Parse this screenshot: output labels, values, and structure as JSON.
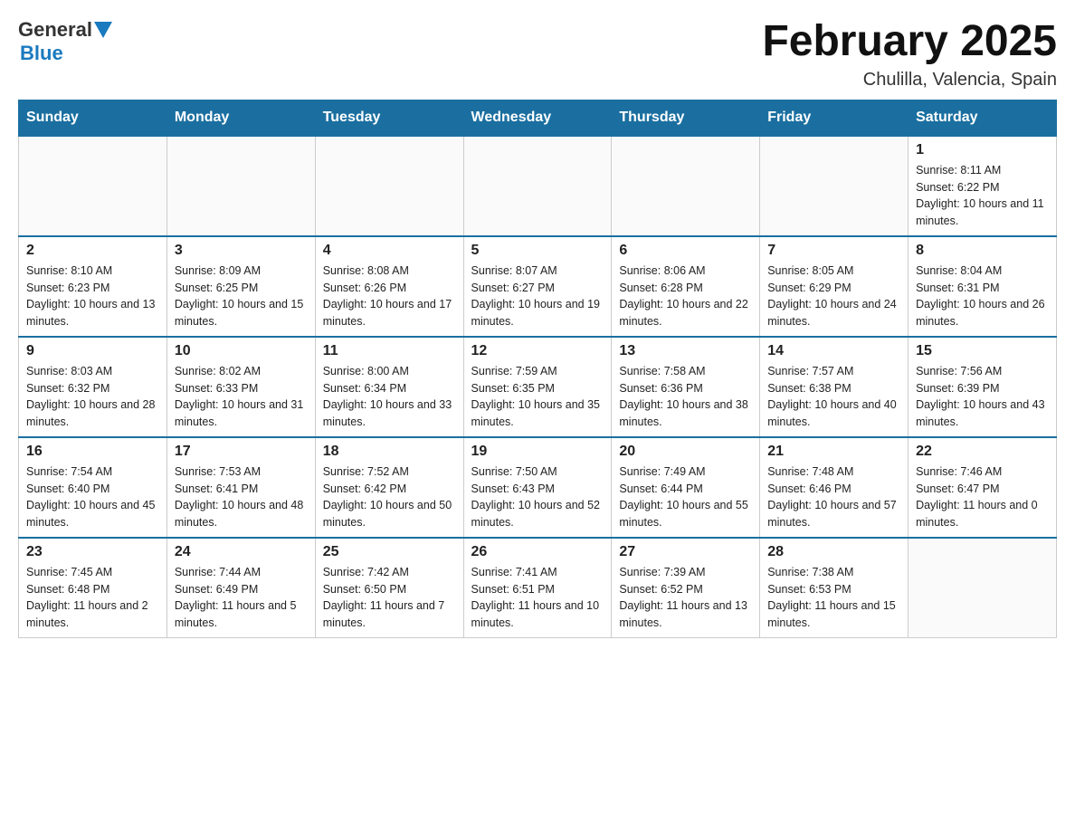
{
  "logo": {
    "general": "General",
    "blue": "Blue"
  },
  "title": "February 2025",
  "subtitle": "Chulilla, Valencia, Spain",
  "days_of_week": [
    "Sunday",
    "Monday",
    "Tuesday",
    "Wednesday",
    "Thursday",
    "Friday",
    "Saturday"
  ],
  "weeks": [
    [
      {
        "day": "",
        "info": ""
      },
      {
        "day": "",
        "info": ""
      },
      {
        "day": "",
        "info": ""
      },
      {
        "day": "",
        "info": ""
      },
      {
        "day": "",
        "info": ""
      },
      {
        "day": "",
        "info": ""
      },
      {
        "day": "1",
        "info": "Sunrise: 8:11 AM\nSunset: 6:22 PM\nDaylight: 10 hours and 11 minutes."
      }
    ],
    [
      {
        "day": "2",
        "info": "Sunrise: 8:10 AM\nSunset: 6:23 PM\nDaylight: 10 hours and 13 minutes."
      },
      {
        "day": "3",
        "info": "Sunrise: 8:09 AM\nSunset: 6:25 PM\nDaylight: 10 hours and 15 minutes."
      },
      {
        "day": "4",
        "info": "Sunrise: 8:08 AM\nSunset: 6:26 PM\nDaylight: 10 hours and 17 minutes."
      },
      {
        "day": "5",
        "info": "Sunrise: 8:07 AM\nSunset: 6:27 PM\nDaylight: 10 hours and 19 minutes."
      },
      {
        "day": "6",
        "info": "Sunrise: 8:06 AM\nSunset: 6:28 PM\nDaylight: 10 hours and 22 minutes."
      },
      {
        "day": "7",
        "info": "Sunrise: 8:05 AM\nSunset: 6:29 PM\nDaylight: 10 hours and 24 minutes."
      },
      {
        "day": "8",
        "info": "Sunrise: 8:04 AM\nSunset: 6:31 PM\nDaylight: 10 hours and 26 minutes."
      }
    ],
    [
      {
        "day": "9",
        "info": "Sunrise: 8:03 AM\nSunset: 6:32 PM\nDaylight: 10 hours and 28 minutes."
      },
      {
        "day": "10",
        "info": "Sunrise: 8:02 AM\nSunset: 6:33 PM\nDaylight: 10 hours and 31 minutes."
      },
      {
        "day": "11",
        "info": "Sunrise: 8:00 AM\nSunset: 6:34 PM\nDaylight: 10 hours and 33 minutes."
      },
      {
        "day": "12",
        "info": "Sunrise: 7:59 AM\nSunset: 6:35 PM\nDaylight: 10 hours and 35 minutes."
      },
      {
        "day": "13",
        "info": "Sunrise: 7:58 AM\nSunset: 6:36 PM\nDaylight: 10 hours and 38 minutes."
      },
      {
        "day": "14",
        "info": "Sunrise: 7:57 AM\nSunset: 6:38 PM\nDaylight: 10 hours and 40 minutes."
      },
      {
        "day": "15",
        "info": "Sunrise: 7:56 AM\nSunset: 6:39 PM\nDaylight: 10 hours and 43 minutes."
      }
    ],
    [
      {
        "day": "16",
        "info": "Sunrise: 7:54 AM\nSunset: 6:40 PM\nDaylight: 10 hours and 45 minutes."
      },
      {
        "day": "17",
        "info": "Sunrise: 7:53 AM\nSunset: 6:41 PM\nDaylight: 10 hours and 48 minutes."
      },
      {
        "day": "18",
        "info": "Sunrise: 7:52 AM\nSunset: 6:42 PM\nDaylight: 10 hours and 50 minutes."
      },
      {
        "day": "19",
        "info": "Sunrise: 7:50 AM\nSunset: 6:43 PM\nDaylight: 10 hours and 52 minutes."
      },
      {
        "day": "20",
        "info": "Sunrise: 7:49 AM\nSunset: 6:44 PM\nDaylight: 10 hours and 55 minutes."
      },
      {
        "day": "21",
        "info": "Sunrise: 7:48 AM\nSunset: 6:46 PM\nDaylight: 10 hours and 57 minutes."
      },
      {
        "day": "22",
        "info": "Sunrise: 7:46 AM\nSunset: 6:47 PM\nDaylight: 11 hours and 0 minutes."
      }
    ],
    [
      {
        "day": "23",
        "info": "Sunrise: 7:45 AM\nSunset: 6:48 PM\nDaylight: 11 hours and 2 minutes."
      },
      {
        "day": "24",
        "info": "Sunrise: 7:44 AM\nSunset: 6:49 PM\nDaylight: 11 hours and 5 minutes."
      },
      {
        "day": "25",
        "info": "Sunrise: 7:42 AM\nSunset: 6:50 PM\nDaylight: 11 hours and 7 minutes."
      },
      {
        "day": "26",
        "info": "Sunrise: 7:41 AM\nSunset: 6:51 PM\nDaylight: 11 hours and 10 minutes."
      },
      {
        "day": "27",
        "info": "Sunrise: 7:39 AM\nSunset: 6:52 PM\nDaylight: 11 hours and 13 minutes."
      },
      {
        "day": "28",
        "info": "Sunrise: 7:38 AM\nSunset: 6:53 PM\nDaylight: 11 hours and 15 minutes."
      },
      {
        "day": "",
        "info": ""
      }
    ]
  ]
}
